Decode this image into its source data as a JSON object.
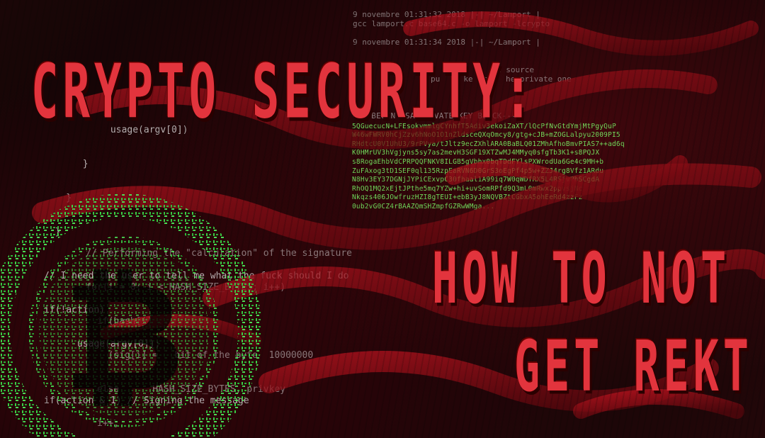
{
  "headline": {
    "title": "CRYPTO SECURITY:",
    "subtitle_line1": "HOW TO NOT",
    "subtitle_line2": "GET REKT"
  },
  "colors": {
    "title_red": "#e2343d",
    "matrix_green": "#7dff6a",
    "swirl_red": "#8a0d16"
  },
  "terminal": {
    "line1": "9 novembre 01:31:32 2018 |-| ~/Lamport |",
    "line2": "gcc lamport.c base64.c -o lamport -lcrypto",
    "line3": "9 novembre 01:31:34 2018 |-| ~/Lamport |",
    "line4": "fr     re source",
    "line5": "pu   c ke  rom  he private one"
  },
  "key_block": {
    "header": "----BEGIN RSA PRIVATE KEY BLOCK----",
    "lines": [
      "5QGuecucN+LFEsokvmmlgCYnhfT5Adiv3ekoiZaXT/lQcPfNvGtdYmjMtPgyQuP",
      "W46wFWRV0hCjZzv6hNoO1O1nZldsceQXqOmcy8/gtg+cJB+mZOGLalpyu2009PI5",
      "RHdtcU0V1UhU3/9rPVya/tJltz9ecZXhlARA0BaBLQ01ZMhAfhoBmvPIAS7++ad6q",
      "K0HMrUV3hVgjyns5sy7as2mevH3SGF19XTZwMJ4MMyq0sfgTb3K1+s8PQJX",
      "s8RogaEhbVdCPRPQQFNKV8ILGB5gVbhx0bqTDdFYlsPXWrodUa6Ge4c9MH+b",
      "ZuFAxog3tD1SEF0ql135RzpEaRVN6D0GrS3oEgPf4p5w+ZZJ4rg8Vfz1ARdu",
      "N8Hv3EY37DGNjJYPiCExvpC30fhaal1A99iq7W0qWDfRX5L4RSjvPhSCgdA",
      "RhOQ1MQ2xEjtJPthe5mq7YZw+hi+uvSomRPfd9Q3mL0mRwx2ppvsjNc",
      "Nkqzs406JOwfruzHZI8gTEUI+ebB3yJ8NQVBZtCGbxA5ohEeRd4zzFz",
      "0ub2vG0CZ4rBAAZQmSHZmpfGZRwWMga..."
    ]
  },
  "code_left": {
    "lines": [
      "            usage(argv[0])",
      "       }",
      "    }",
      "  }",
      "// I need the user to tell me what the fuck should I do",
      "if(!action)",
      "      usage(argv[0]);",
      "",
      "if(action & 1) // Signing the message"
    ]
  },
  "code_mid": {
    "lines": [
      "    // Performing the \"calculation\" of the signature",
      "    for(i = 0; i < HASH_SIZE_BYTES; i++)",
      "      if(hash[i] ...",
      "        (sig[i] =   bit of the byte  10000000",
      "      else      HASH_SIZE_BYTES, privkey",
      "      i++;"
    ]
  }
}
